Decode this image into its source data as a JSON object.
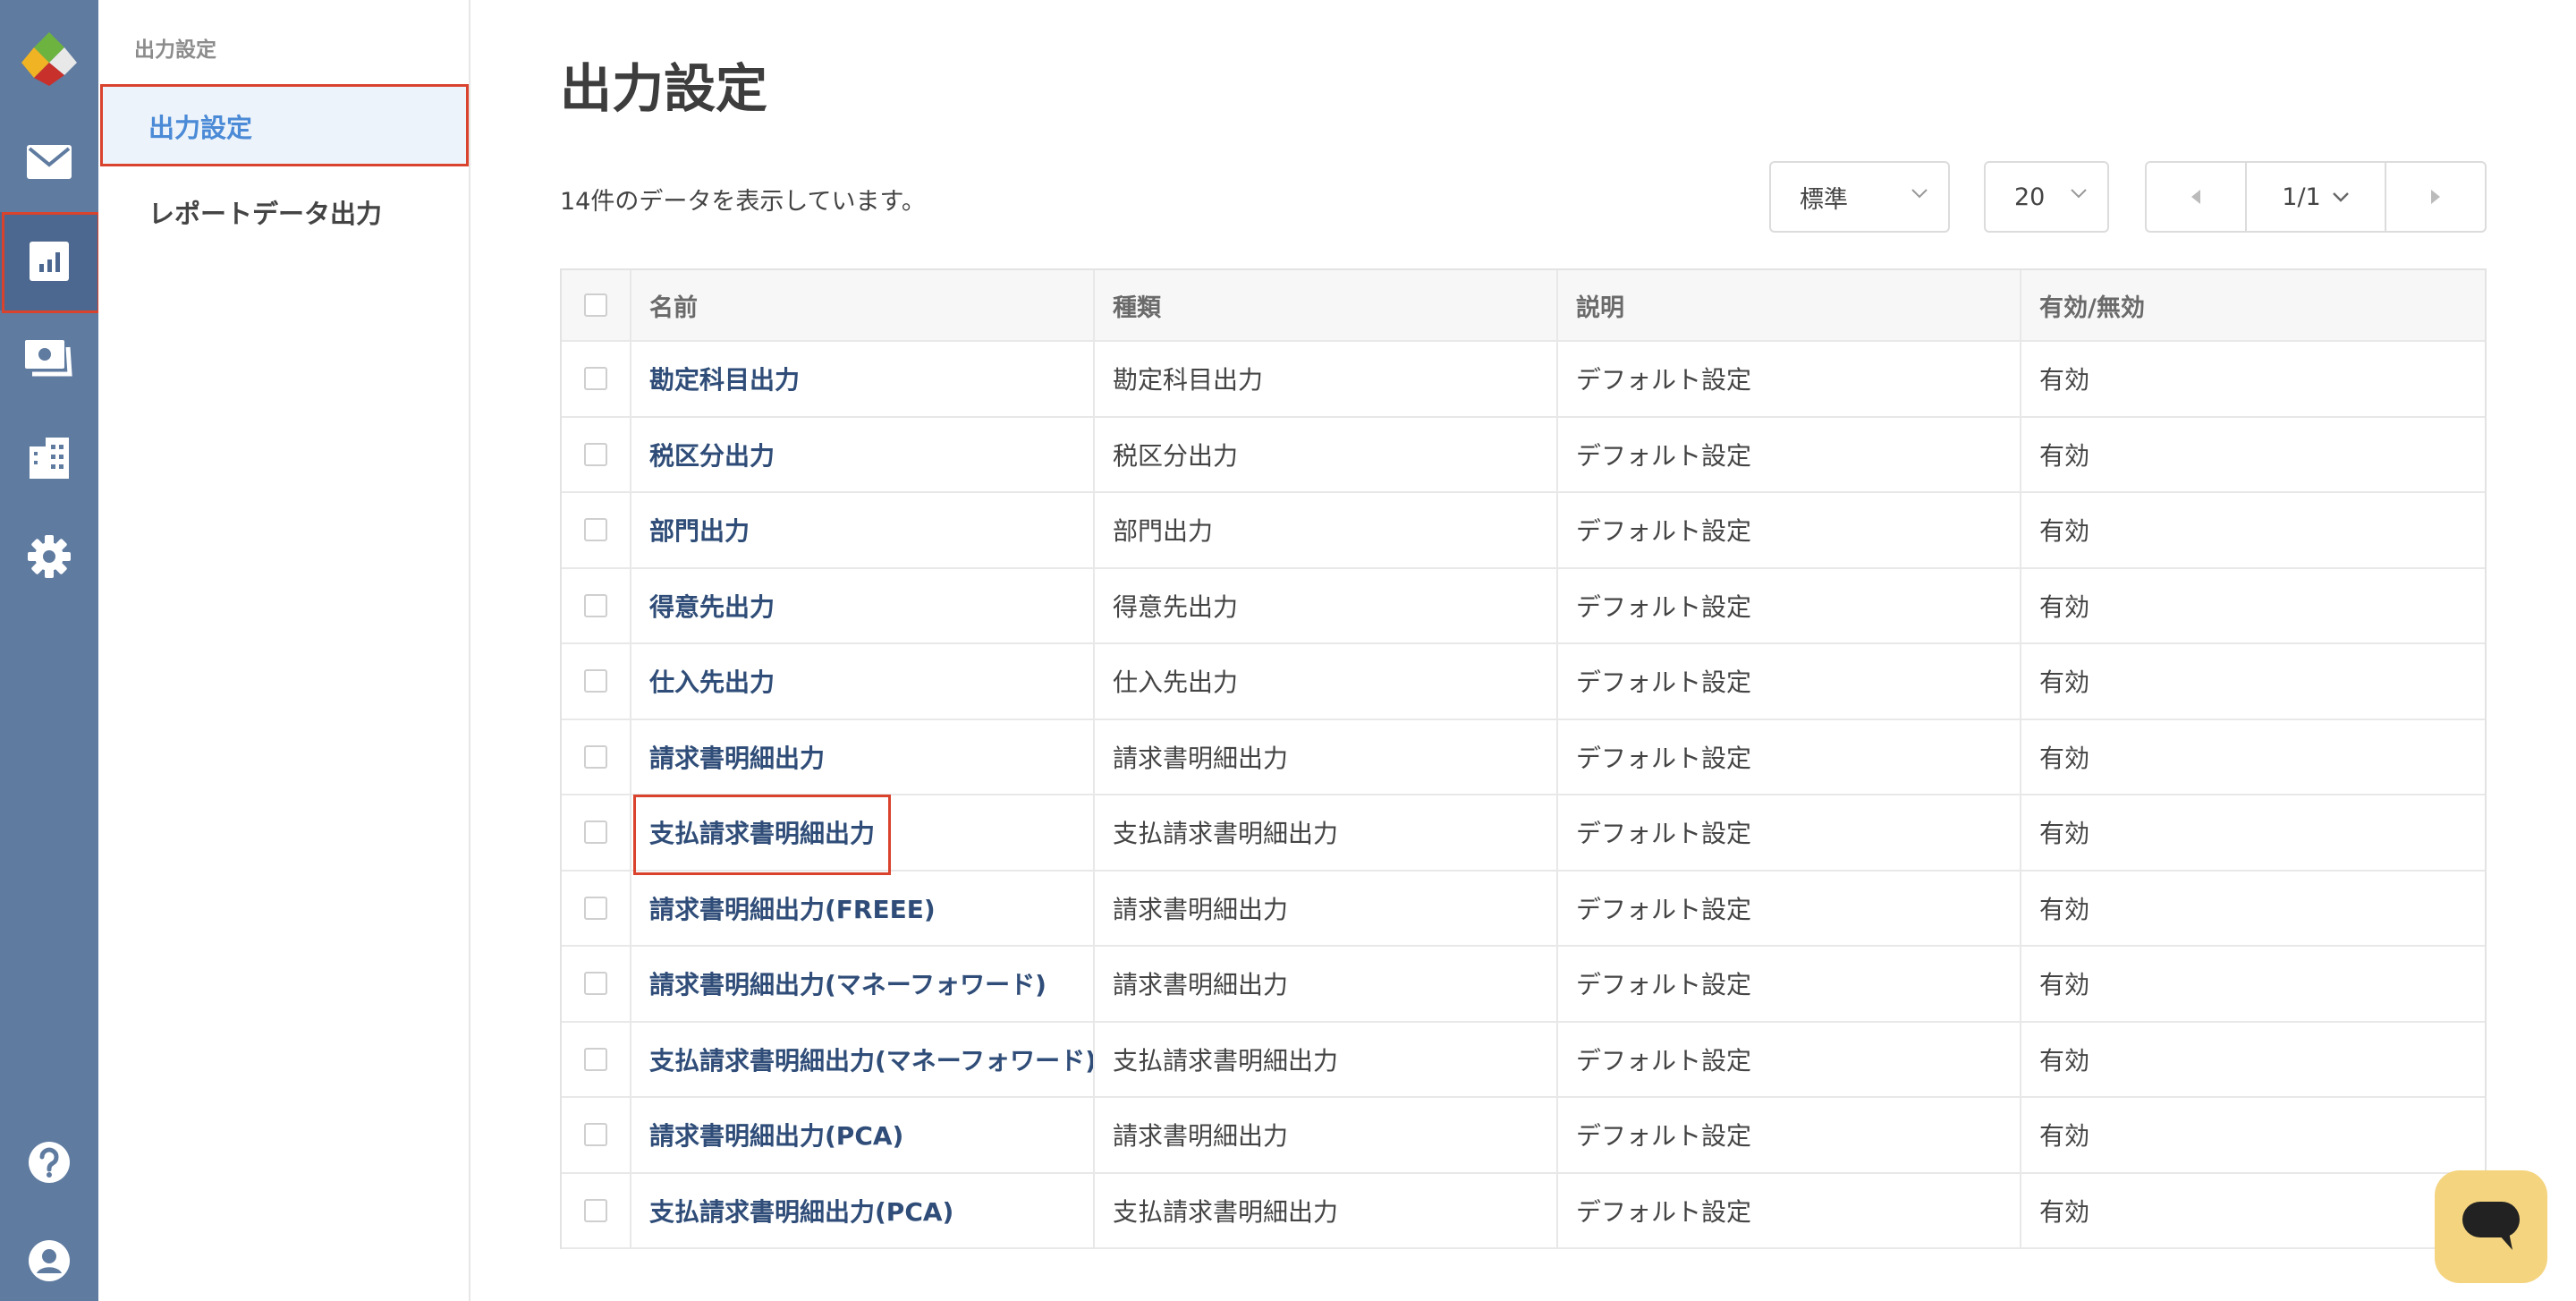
{
  "rail": {
    "items": [
      {
        "name": "app-logo",
        "icon": "logo-icon"
      },
      {
        "name": "mail",
        "icon": "mail-icon"
      },
      {
        "name": "reports",
        "icon": "chart-icon",
        "selected": true
      },
      {
        "name": "payments",
        "icon": "money-icon"
      },
      {
        "name": "company",
        "icon": "building-icon"
      },
      {
        "name": "settings",
        "icon": "gear-icon"
      },
      {
        "name": "help",
        "icon": "help-icon"
      },
      {
        "name": "account",
        "icon": "user-icon"
      }
    ]
  },
  "subnav": {
    "heading": "出力設定",
    "items": [
      {
        "label": "出力設定",
        "active": true
      },
      {
        "label": "レポートデータ出力",
        "active": false
      }
    ]
  },
  "main": {
    "title": "出力設定",
    "count_text": "14件のデータを表示しています。",
    "view_select": "標準",
    "page_size": "20",
    "pagination": "1/1"
  },
  "table": {
    "headers": [
      "名前",
      "種類",
      "説明",
      "有効/無効"
    ],
    "rows": [
      [
        "勘定科目出力",
        "勘定科目出力",
        "デフォルト設定",
        "有効"
      ],
      [
        "税区分出力",
        "税区分出力",
        "デフォルト設定",
        "有効"
      ],
      [
        "部門出力",
        "部門出力",
        "デフォルト設定",
        "有効"
      ],
      [
        "得意先出力",
        "得意先出力",
        "デフォルト設定",
        "有効"
      ],
      [
        "仕入先出力",
        "仕入先出力",
        "デフォルト設定",
        "有効"
      ],
      [
        "請求書明細出力",
        "請求書明細出力",
        "デフォルト設定",
        "有効"
      ],
      [
        "支払請求書明細出力",
        "支払請求書明細出力",
        "デフォルト設定",
        "有効"
      ],
      [
        "請求書明細出力(FREEE)",
        "請求書明細出力",
        "デフォルト設定",
        "有効"
      ],
      [
        "請求書明細出力(マネーフォワード)",
        "請求書明細出力",
        "デフォルト設定",
        "有効"
      ],
      [
        "支払請求書明細出力(マネーフォワード)",
        "支払請求書明細出力",
        "デフォルト設定",
        "有効"
      ],
      [
        "請求書明細出力(PCA)",
        "請求書明細出力",
        "デフォルト設定",
        "有効"
      ],
      [
        "支払請求書明細出力(PCA)",
        "支払請求書明細出力",
        "デフォルト設定",
        "有効"
      ]
    ]
  },
  "colors": {
    "rail": "#5f7ba0",
    "accent": "#4a8ad6",
    "link": "#2f4d78",
    "highlight": "#d9432d",
    "chat": "#f4d47f"
  }
}
